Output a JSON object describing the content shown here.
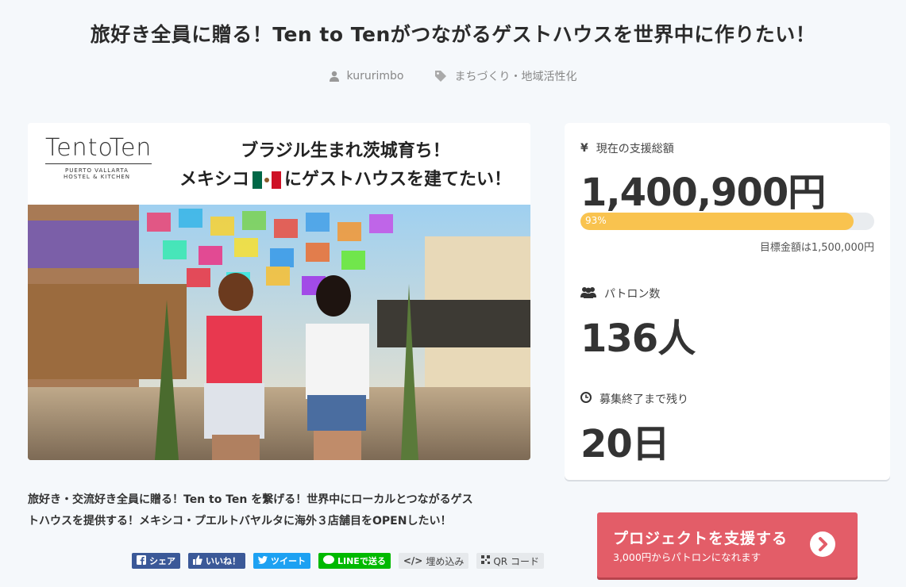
{
  "project": {
    "title": "旅好き全員に贈る！Ten to Tenがつながるゲストハウスを世界中に作りたい！",
    "author": "kururimbo",
    "category": "まちづくり・地域活性化",
    "description_line1": "旅好き・交流好き全員に贈る！Ten to Ten を繋げる！世界中にローカルとつながるゲス",
    "description_line2": "トハウスを提供する！メキシコ・プエルトバヤルタに海外３店舗目をOPENしたい！"
  },
  "banner": {
    "logo_text": "TentoTen",
    "logo_sub1": "PUERTO VALLARTA",
    "logo_sub2": "HOSTEL & KITCHEN",
    "headline_line1": "ブラジル生まれ茨城育ち！",
    "headline_line2_a": "メキシコ",
    "headline_line2_b": "にゲストハウスを建てたい！"
  },
  "stats": {
    "funding_label": "現在の支援総額",
    "funding_value": "1,400,900円",
    "progress_pct_label": "93%",
    "progress_fraction": 0.93,
    "goal_text": "目標金額は1,500,000円",
    "patrons_label": "パトロン数",
    "patrons_value": "136人",
    "remaining_label": "募集終了まで残り",
    "remaining_value": "20日"
  },
  "share": {
    "facebook": "シェア",
    "like": "いいね！",
    "twitter": "ツイート",
    "line": "LINEで送る",
    "embed": "埋め込み",
    "qr": "QR コード"
  },
  "cta": {
    "main": "プロジェクトを支援する",
    "sub": "3,000円からパトロンになれます"
  },
  "colors": {
    "accent": "#e35d68",
    "progress": "#f9c34f",
    "facebook": "#3b5998",
    "twitter": "#1da1f2",
    "line": "#00b900"
  }
}
